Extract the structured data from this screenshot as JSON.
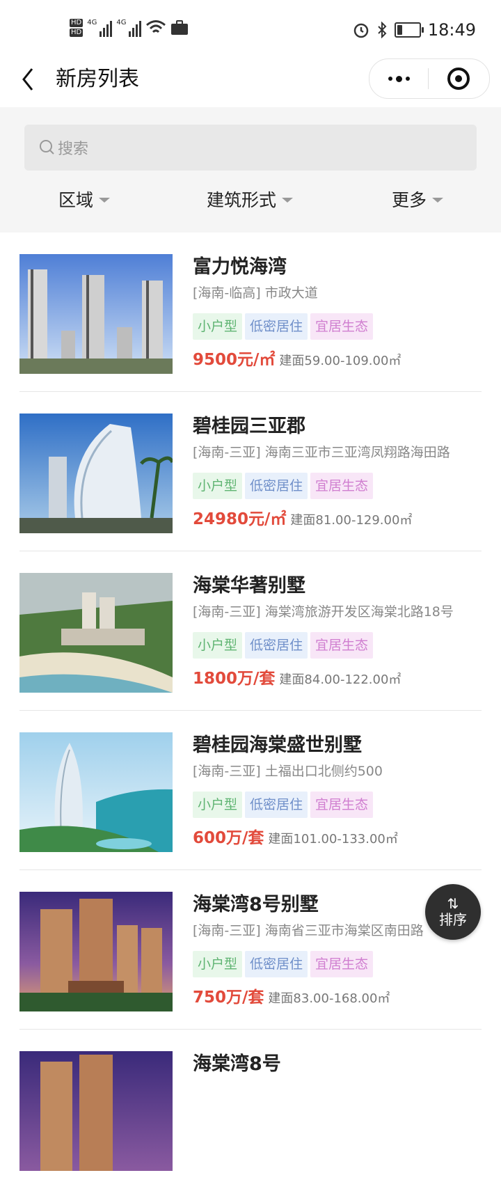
{
  "status_bar": {
    "time": "18:49",
    "network": "4G",
    "battery_level": 0.22,
    "icons": [
      "hd-icon",
      "signal-icon",
      "wifi-icon",
      "briefcase-icon",
      "alarm-icon",
      "bluetooth-icon",
      "battery-icon"
    ]
  },
  "nav": {
    "title": "新房列表",
    "icons": [
      "back-chevron-icon",
      "more-dots-icon",
      "close-target-icon"
    ]
  },
  "search": {
    "placeholder": "搜索"
  },
  "filters": [
    {
      "label": "区域"
    },
    {
      "label": "建筑形式"
    },
    {
      "label": "更多"
    }
  ],
  "listings": [
    {
      "name": "富力悦海湾",
      "address": "[海南-临高] 市政大道",
      "tags": [
        "小户型",
        "低密居住",
        "宜居生态"
      ],
      "price": "9500元/㎡",
      "area": "建面59.00-109.00㎡"
    },
    {
      "name": "碧桂园三亚郡",
      "address": "[海南-三亚] 海南三亚市三亚湾凤翔路海田路",
      "tags": [
        "小户型",
        "低密居住",
        "宜居生态"
      ],
      "price": "24980元/㎡",
      "area": "建面81.00-129.00㎡"
    },
    {
      "name": "海棠华著别墅",
      "address": "[海南-三亚] 海棠湾旅游开发区海棠北路18号",
      "tags": [
        "小户型",
        "低密居住",
        "宜居生态"
      ],
      "price": "1800万/套",
      "area": "建面84.00-122.00㎡"
    },
    {
      "name": "碧桂园海棠盛世别墅",
      "address": "[海南-三亚] 土福出口北侧约500",
      "tags": [
        "小户型",
        "低密居住",
        "宜居生态"
      ],
      "price": "600万/套",
      "area": "建面101.00-133.00㎡"
    },
    {
      "name": "海棠湾8号别墅",
      "address": "[海南-三亚] 海南省三亚市海棠区南田路",
      "tags": [
        "小户型",
        "低密居住",
        "宜居生态"
      ],
      "price": "750万/套",
      "area": "建面83.00-168.00㎡"
    },
    {
      "name": "海棠湾8号",
      "address": "",
      "tags": [],
      "price": "",
      "area": ""
    }
  ],
  "sort_button": {
    "label": "排序",
    "arrows": "⇅"
  },
  "colors": {
    "price": "#e24a3b",
    "tag_green": "#5fb472",
    "tag_blue": "#6f8fc9",
    "tag_pink": "#d07ed0",
    "filter_bg": "#f5f5f5"
  }
}
